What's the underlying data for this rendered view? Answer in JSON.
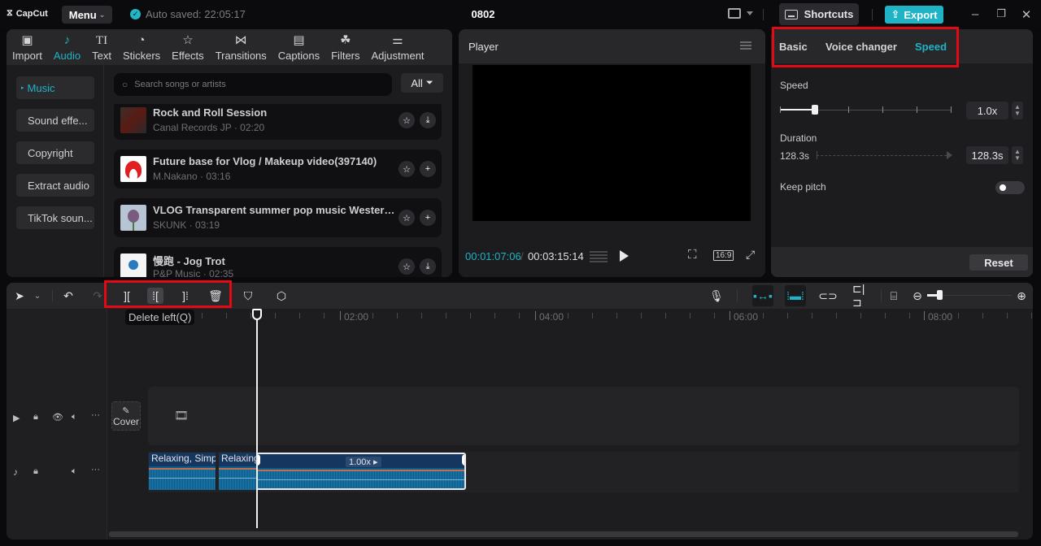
{
  "titlebar": {
    "app_name": "CapCut",
    "menu_label": "Menu",
    "autosave_text": "Auto saved: 22:05:17",
    "project_title": "0802",
    "shortcuts_label": "Shortcuts",
    "export_label": "Export",
    "accent_color": "#1fb3c5"
  },
  "media_toolbar": {
    "items": [
      {
        "label": "Import",
        "icon": "import-icon"
      },
      {
        "label": "Audio",
        "icon": "music-note-icon",
        "active": true
      },
      {
        "label": "Text",
        "icon": "text-icon"
      },
      {
        "label": "Stickers",
        "icon": "sticker-icon"
      },
      {
        "label": "Effects",
        "icon": "effects-star-icon"
      },
      {
        "label": "Transitions",
        "icon": "transition-bowtie-icon"
      },
      {
        "label": "Captions",
        "icon": "captions-icon"
      },
      {
        "label": "Filters",
        "icon": "filters-icon"
      },
      {
        "label": "Adjustment",
        "icon": "adjustment-sliders-icon"
      }
    ]
  },
  "audio_nav": {
    "items": [
      {
        "label": "Music",
        "active": true
      },
      {
        "label": "Sound effe..."
      },
      {
        "label": "Copyright"
      },
      {
        "label": "Extract audio"
      },
      {
        "label": "TikTok soun..."
      }
    ]
  },
  "search": {
    "placeholder": "Search songs or artists",
    "filter_label": "All"
  },
  "songs": [
    {
      "title": "Rock and Roll Session",
      "sub": "Canal Records JP · 02:20",
      "action": "download"
    },
    {
      "title": "Future base for Vlog / Makeup video(397140)",
      "sub": "M.Nakano · 03:16",
      "action": "add"
    },
    {
      "title": "VLOG Transparent summer pop music Western...",
      "sub": "SKUNK · 03:19",
      "action": "add"
    },
    {
      "title": "慢跑 - Jog Trot",
      "sub": "P&P Music · 02:35",
      "action": "download"
    }
  ],
  "player": {
    "title": "Player",
    "current_time": "00:01:07:06",
    "total_time": "00:03:15:14",
    "ratio": "16:9"
  },
  "inspector": {
    "tabs": [
      {
        "label": "Basic"
      },
      {
        "label": "Voice changer"
      },
      {
        "label": "Speed",
        "active": true
      }
    ],
    "speed_label": "Speed",
    "speed_value": "1.0x",
    "speed_slider_fraction": 0.2,
    "duration_label": "Duration",
    "duration_from": "128.3s",
    "duration_value": "128.3s",
    "keep_pitch_label": "Keep pitch",
    "keep_pitch_on": false,
    "reset_label": "Reset"
  },
  "timeline": {
    "tooltip": "Delete left(Q)",
    "ruler_labels": [
      "02:00",
      "04:00",
      "06:00",
      "08:00"
    ],
    "cover_label": "Cover",
    "clips": [
      {
        "label": "Relaxing, Simpl"
      },
      {
        "label": "Relaxing"
      },
      {
        "label": "",
        "speed_tag": "1.00x ▸",
        "selected": true
      }
    ]
  }
}
